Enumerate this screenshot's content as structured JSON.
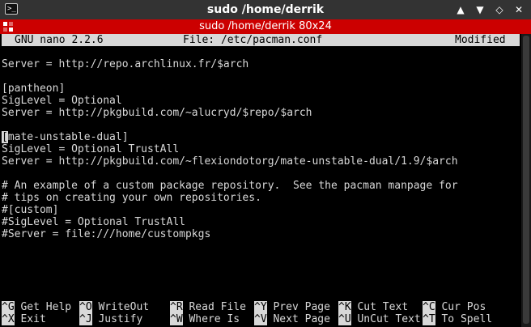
{
  "window": {
    "title": "sudo  /home/derrik",
    "tab_title": "sudo  /home/derrik 80x24",
    "icon_glyph": ">_",
    "buttons": {
      "up": "▲",
      "down": "▼",
      "maximize": "◇",
      "close": "✕"
    }
  },
  "nano": {
    "app": "GNU nano 2.2.6",
    "file": "File: /etc/pacman.conf",
    "status": "Modified"
  },
  "editor": {
    "lines": [
      "",
      "Server = http://repo.archlinux.fr/$arch",
      "",
      "[pantheon]",
      "SigLevel = Optional",
      "Server = http://pkgbuild.com/~alucryd/$repo/$arch",
      "",
      "mate-unstable-dual]",
      "SigLevel = Optional TrustAll",
      "Server = http://pkgbuild.com/~flexiondotorg/mate-unstable-dual/1.9/$arch",
      "",
      "# An example of a custom package repository.  See the pacman manpage for",
      "# tips on creating your own repositories.",
      "#[custom]",
      "#SigLevel = Optional TrustAll",
      "#Server = file:///home/custompkgs",
      "",
      "",
      "",
      "",
      ""
    ],
    "cursor_char": "["
  },
  "shortcuts": [
    {
      "key": "^G",
      "label": "Get Help"
    },
    {
      "key": "^O",
      "label": "WriteOut"
    },
    {
      "key": "^R",
      "label": "Read File"
    },
    {
      "key": "^Y",
      "label": "Prev Page"
    },
    {
      "key": "^K",
      "label": "Cut Text"
    },
    {
      "key": "^C",
      "label": "Cur Pos"
    },
    {
      "key": "^X",
      "label": "Exit"
    },
    {
      "key": "^J",
      "label": "Justify"
    },
    {
      "key": "^W",
      "label": "Where Is"
    },
    {
      "key": "^V",
      "label": "Next Page"
    },
    {
      "key": "^U",
      "label": "UnCut Text"
    },
    {
      "key": "^T",
      "label": "To Spell"
    }
  ],
  "colors": {
    "titlebar": "#333333",
    "tabbar": "#cc0000",
    "terminal_bg": "#000000",
    "terminal_fg": "#d8d8d8"
  }
}
